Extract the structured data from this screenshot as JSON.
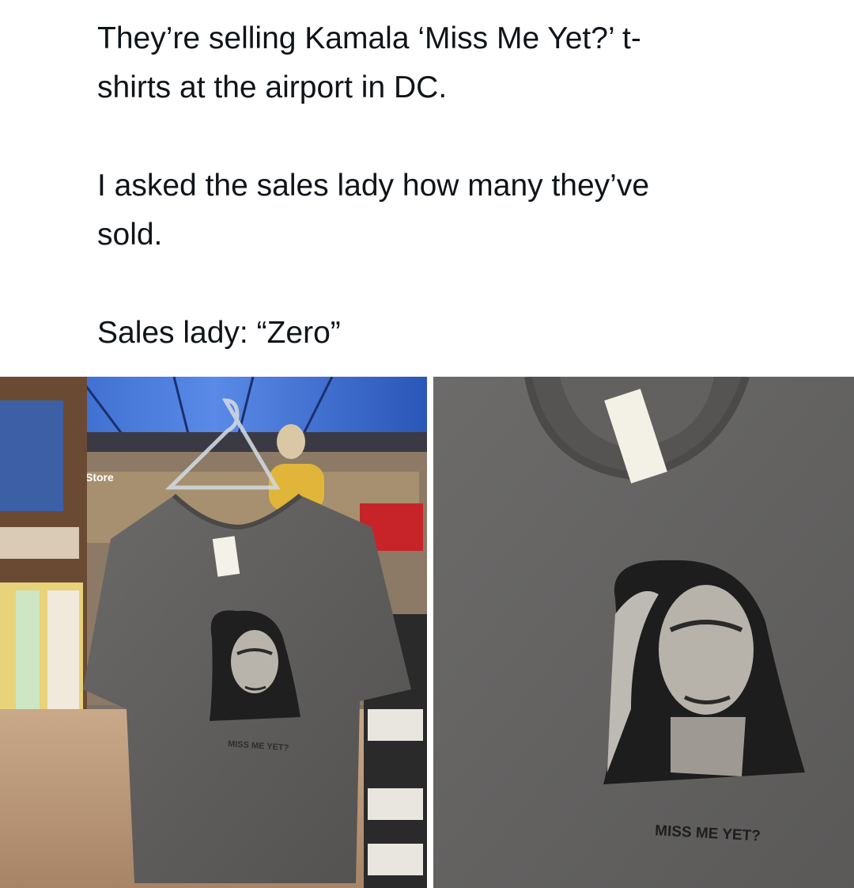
{
  "caption": {
    "line1": "They’re selling Kamala ‘Miss Me Yet?’ t-",
    "line2": "shirts at the airport in DC.",
    "line3": "I asked the sales lady how many they’ve",
    "line4": "sold.",
    "line5": "Sales lady: “Zero”"
  },
  "photos": {
    "left": {
      "store_sign": "Store",
      "shirt_print": "MISS ME YET?"
    },
    "right": {
      "shirt_print": "MISS ME YET?"
    }
  },
  "colors": {
    "text": "#0f1419",
    "shirt_gray": "#5e5d5c",
    "ceiling_blue": "#3b6fd1"
  }
}
